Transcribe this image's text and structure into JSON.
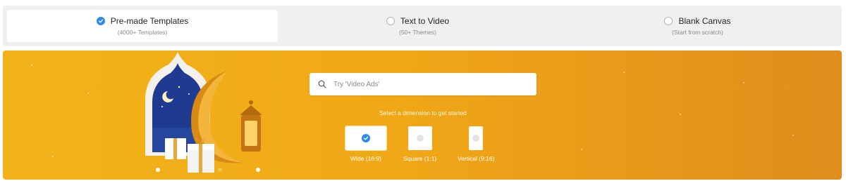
{
  "tabs": [
    {
      "title": "Pre-made Templates",
      "sub": "(4000+ Templates)",
      "selected": true
    },
    {
      "title": "Text to Video",
      "sub": "(50+ Themes)",
      "selected": false
    },
    {
      "title": "Blank Canvas",
      "sub": "(Start from scratch)",
      "selected": false
    }
  ],
  "search": {
    "placeholder": "Try 'Video Ads'",
    "value": ""
  },
  "prompt": "Select a dimension to get started",
  "dimensions": [
    {
      "label": "Wide (16:9)",
      "selected": true
    },
    {
      "label": "Square (1:1)",
      "selected": false
    },
    {
      "label": "Vertical (9:16)",
      "selected": false
    }
  ],
  "colors": {
    "accent": "#2f8be6",
    "banner": "#f0a916",
    "tab_bg": "#f0f0f0"
  }
}
